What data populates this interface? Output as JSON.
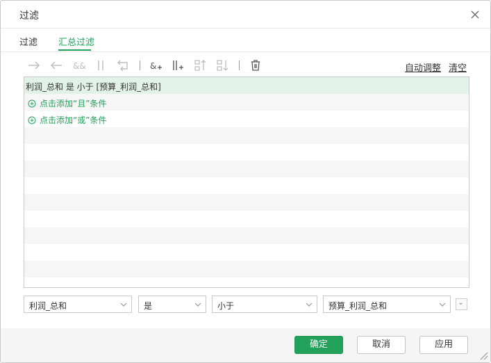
{
  "dialog": {
    "title": "过滤"
  },
  "tabs": [
    {
      "label": "过滤",
      "active": false
    },
    {
      "label": "汇总过滤",
      "active": true
    }
  ],
  "toolbar": {
    "icons": [
      "indent-right-icon",
      "indent-left-icon",
      "and-icon",
      "or-icon",
      "wrap-icon",
      "add-and-icon",
      "add-or-icon",
      "move-up-icon",
      "move-down-icon",
      "delete-icon"
    ],
    "auto_adjust_label": "自动调整",
    "clear_label": "清空"
  },
  "conditions": {
    "selected_text": "利润_总和 是 小于 [预算_利润_总和]",
    "add_and_label": "点击添加“且”条件",
    "add_or_label": "点击添加“或”条件"
  },
  "editor": {
    "field_value": "利润_总和",
    "operator_value": "是",
    "comparison_value": "小于",
    "target_value": "预算_利润_总和"
  },
  "buttons": {
    "ok": "确定",
    "cancel": "取消",
    "apply": "应用"
  },
  "colors": {
    "accent": "#21a15a",
    "selected_row": "#e3f2e8"
  }
}
